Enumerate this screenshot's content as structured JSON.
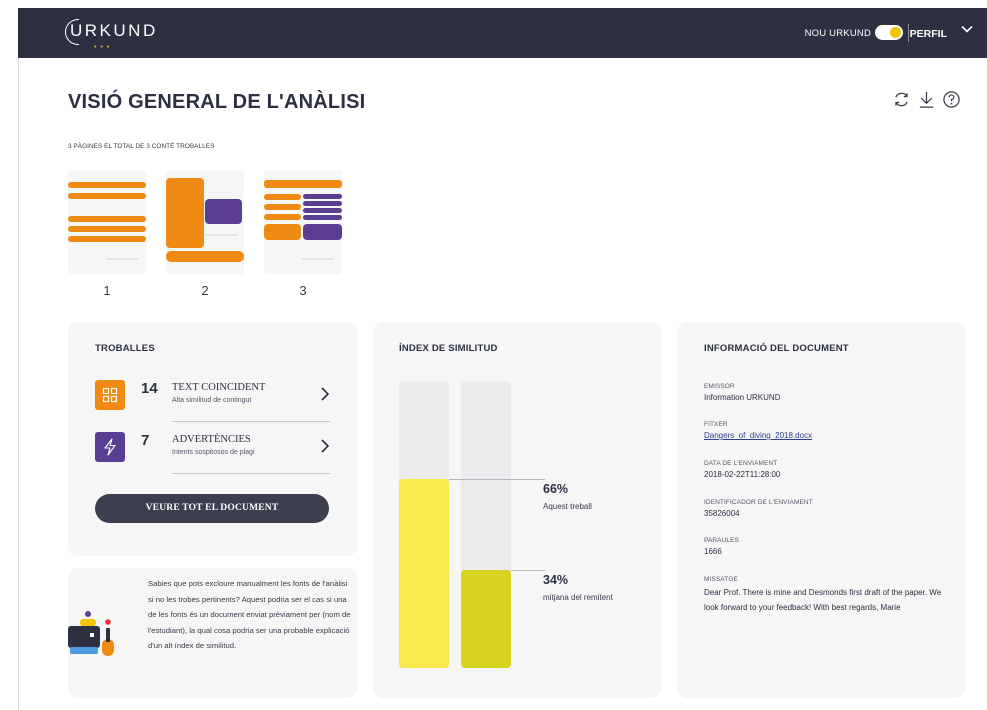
{
  "app": {
    "logo": "URKUND",
    "new_urkund_label": "NOU URKUND",
    "profile_label": "PERFIL",
    "accent_color": "#f5c300",
    "topbar_color": "#2c3040"
  },
  "header": {
    "title": "VISIÓ GENERAL DE L'ANÀLISI",
    "subtitle": "3 PÀGINES EL TOTAL DE 3 CONTÉ TROBALLES",
    "icons": [
      "refresh-icon",
      "download-icon",
      "help-icon"
    ]
  },
  "pages": [
    {
      "label": "1"
    },
    {
      "label": "2"
    },
    {
      "label": "3"
    }
  ],
  "findings": {
    "title": "TROBALLES",
    "items": [
      {
        "count": "14",
        "label": "TEXT COINCIDENT",
        "sub": "Alta similitud de contingut",
        "icon": "grid-icon",
        "color": "#f08a13"
      },
      {
        "count": "7",
        "label": "ADVERTÈNCIES",
        "sub": "Intents sospitosos de plagi",
        "icon": "lightning-icon",
        "color": "#5a3e94"
      }
    ],
    "button": "VEURE TOT EL DOCUMENT"
  },
  "tip": {
    "text": "Sabies que pots excloure manualment les fonts de l'anàlisi si no les trobes pertinents? Aquest podria ser el cas si una de les fonts és un document enviat prèviament per (nom de l'estudiant), la qual cosa podria ser una probable explicació d'un alt índex de similitud."
  },
  "similarity": {
    "title": "ÍNDEX DE SIMILITUD",
    "this_work_pct": "66%",
    "this_work_label": "Aquest treball",
    "this_work_value": 0.66,
    "sender_avg_pct": "34%",
    "sender_avg_label": "mitjana del remitent",
    "sender_avg_value": 0.34,
    "colors": {
      "this_work": "#f9e84e",
      "sender_avg": "#d8d220",
      "track": "#ececee"
    }
  },
  "document_info": {
    "title": "INFORMACIÓ DEL DOCUMENT",
    "fields": [
      {
        "label": "EMISSOR",
        "value": "Information URKUND"
      },
      {
        "label": "FITXER",
        "value": "Dangers_of_diving_2018.docx"
      },
      {
        "label": "DATA DE L'ENVIAMENT",
        "value": "2018-02-22T11:28:00"
      },
      {
        "label": "IDENTIFICADOR DE L'ENVIAMENT",
        "value": "35826004"
      },
      {
        "label": "PARAULES",
        "value": "1666"
      },
      {
        "label": "MISSATGE",
        "value": "Dear Prof. There is mine and Desmonds first draft of the paper. We look forward to your feedback! With best regards, Marie"
      }
    ]
  }
}
